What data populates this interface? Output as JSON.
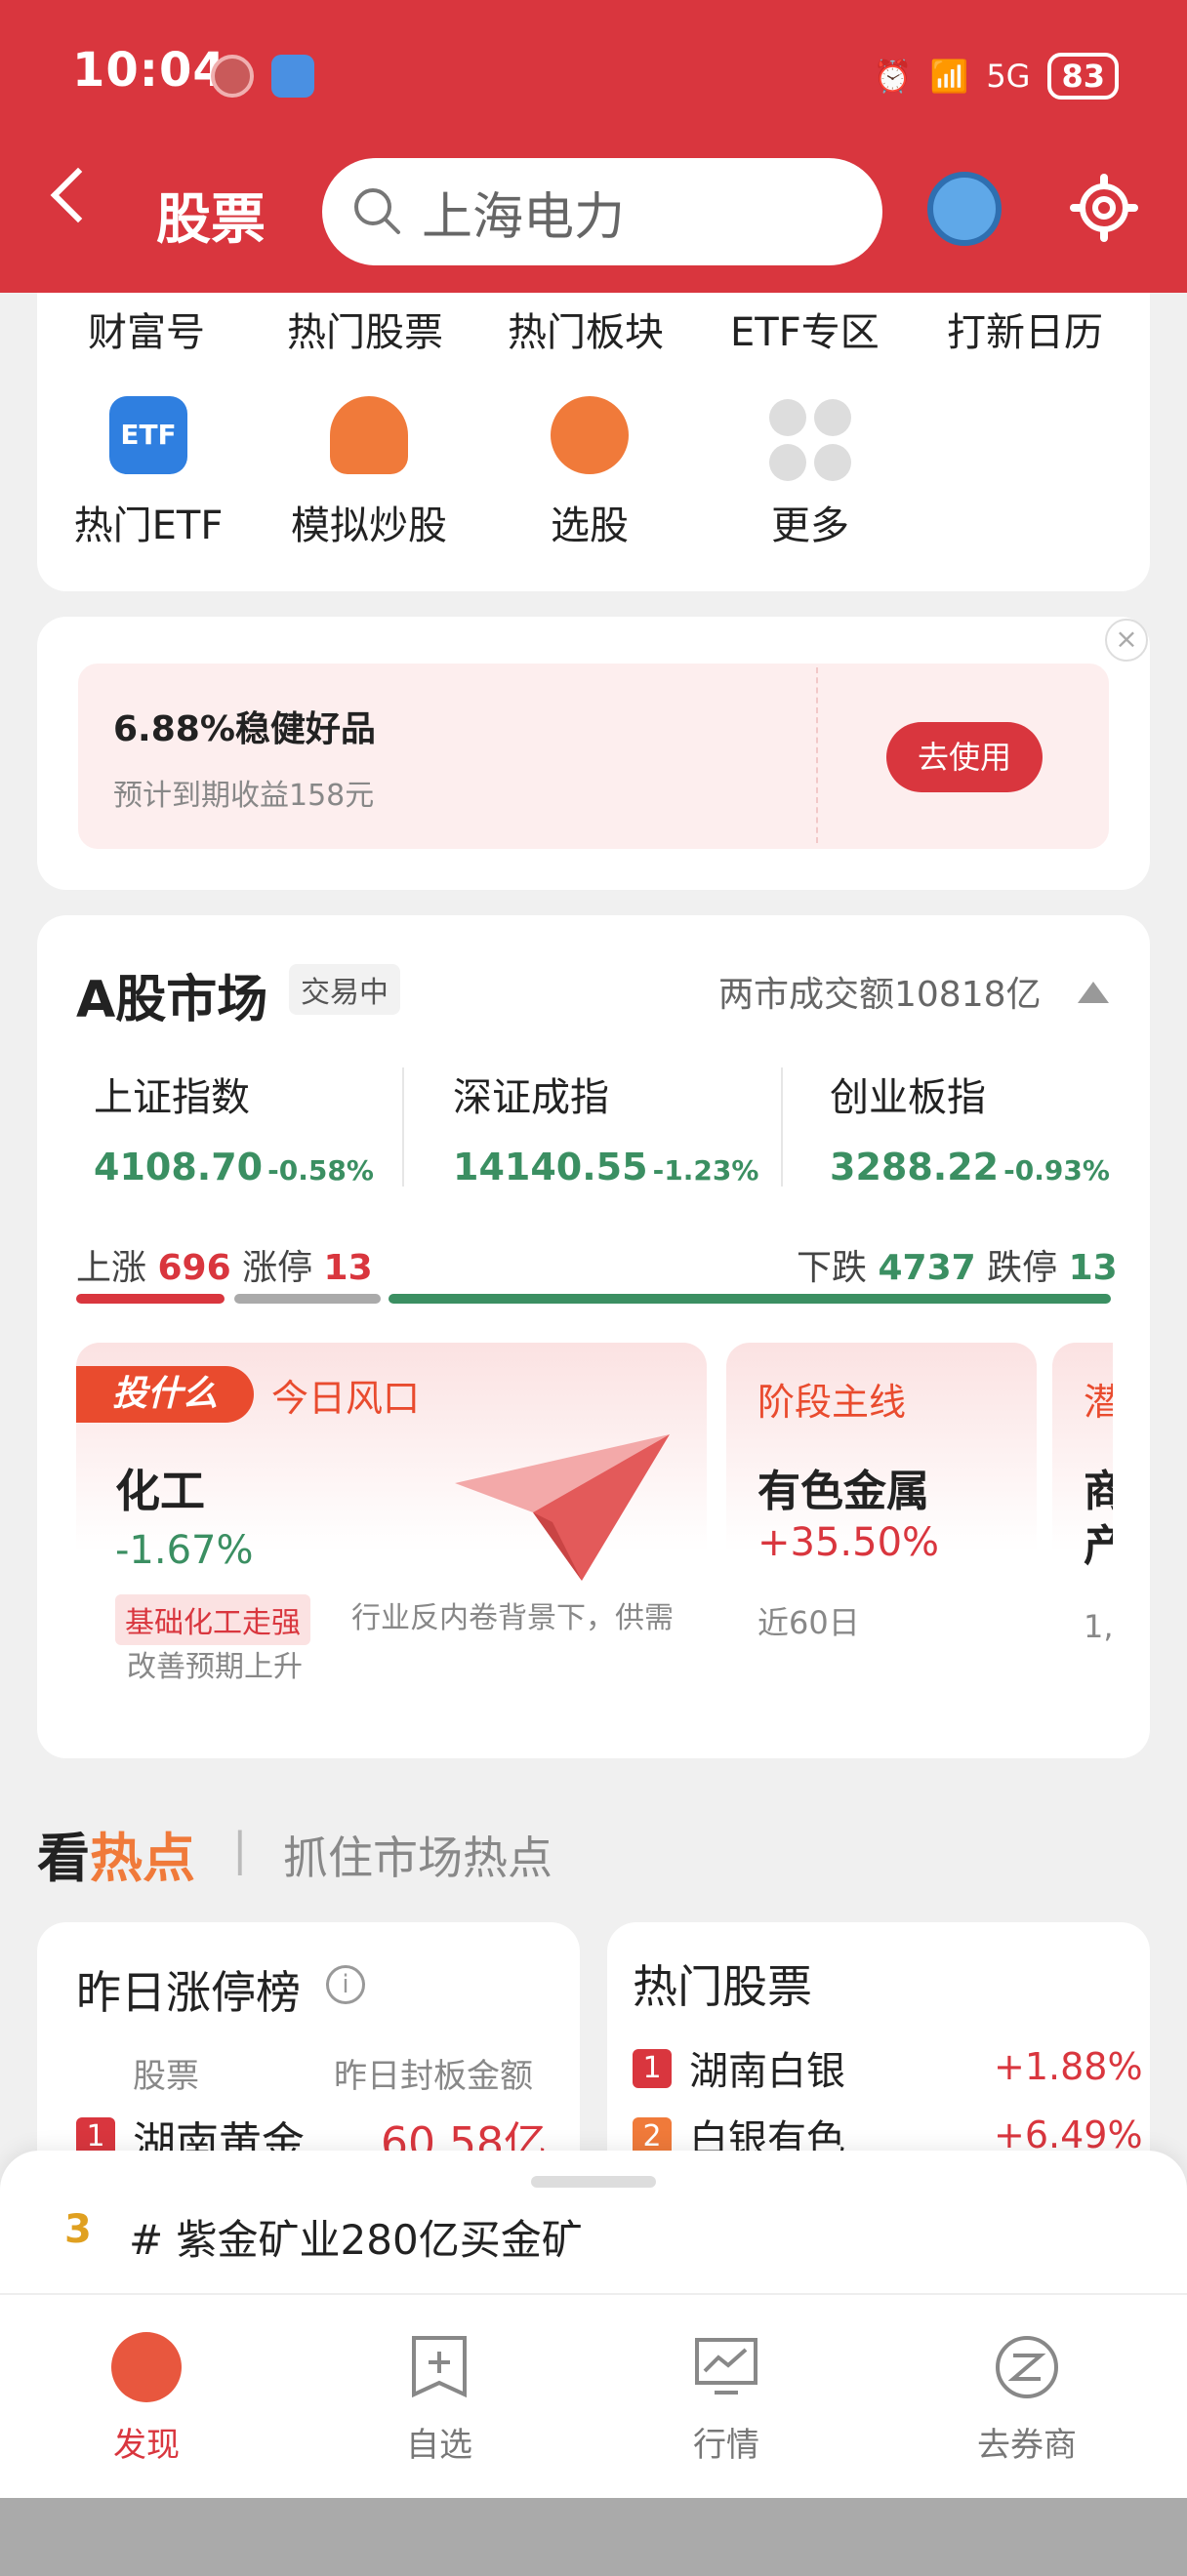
{
  "status": {
    "time": "10:04",
    "battery": "83",
    "network": "5G"
  },
  "header": {
    "title": "股票",
    "search_text": "上海电力"
  },
  "top_tabs": [
    "财富号",
    "热门股票",
    "热门板块",
    "ETF专区",
    "打新日历"
  ],
  "quick_items": [
    {
      "label": "热门ETF",
      "icon": "etf-icon",
      "badge": "ETF"
    },
    {
      "label": "模拟炒股",
      "icon": "trophy-icon"
    },
    {
      "label": "选股",
      "icon": "stock-pick-icon"
    },
    {
      "label": "更多",
      "icon": "more-grid-icon"
    }
  ],
  "promo": {
    "title": "6.88%稳健好品",
    "subtitle": "预计到期收益158元",
    "button": "去使用",
    "close": "×"
  },
  "market": {
    "title": "A股市场",
    "status": "交易中",
    "volume": "两市成交额10818亿",
    "indices": [
      {
        "name": "上证指数",
        "value": "4108.70",
        "change": "-0.58%"
      },
      {
        "name": "深证成指",
        "value": "14140.55",
        "change": "-1.23%"
      },
      {
        "name": "创业板指",
        "value": "3288.22",
        "change": "-0.93%"
      }
    ],
    "breadth": {
      "up_label": "上涨",
      "up": "696",
      "limit_up_label": "涨停",
      "limit_up": "13",
      "down_label": "下跌",
      "down": "4737",
      "limit_down_label": "跌停",
      "limit_down": "13"
    }
  },
  "tiles": [
    {
      "brand": "投什么",
      "tag": "今日风口",
      "name": "化工",
      "change": "-1.67%",
      "chip": "基础化工走强",
      "desc": "行业反内卷背景下，供需改善预期上升"
    },
    {
      "tag": "阶段主线",
      "name": "有色金属",
      "change": "+35.50%",
      "period": "近60日"
    },
    {
      "tag": "潜",
      "name": "商",
      "name2": "产",
      "period": "1,"
    }
  ],
  "hot": {
    "title_a": "看",
    "title_b": "热点",
    "divider": "|",
    "subtitle": "抓住市场热点"
  },
  "limit_up_board": {
    "title": "昨日涨停榜",
    "col1": "股票",
    "col2": "昨日封板金额",
    "rows": [
      {
        "rank": "1",
        "name": "湖南黄金",
        "amount": "60.58亿"
      }
    ]
  },
  "hot_stocks": {
    "title": "热门股票",
    "rows": [
      {
        "rank": "1",
        "name": "湖南白银",
        "change": "+1.88%"
      },
      {
        "rank": "2",
        "name": "白银有色",
        "change": "+6.49%"
      }
    ]
  },
  "trend": {
    "rank": "3",
    "text": "# 紫金矿业280亿买金矿"
  },
  "bottom_nav": [
    {
      "label": "发现",
      "icon": "compass-icon",
      "active": true
    },
    {
      "label": "自选",
      "icon": "bookmark-plus-icon"
    },
    {
      "label": "行情",
      "icon": "chart-monitor-icon"
    },
    {
      "label": "去券商",
      "icon": "broker-icon"
    }
  ],
  "colors": {
    "brand_red": "#d9363e",
    "up_red": "#d9363e",
    "down_green": "#3b8f62"
  }
}
